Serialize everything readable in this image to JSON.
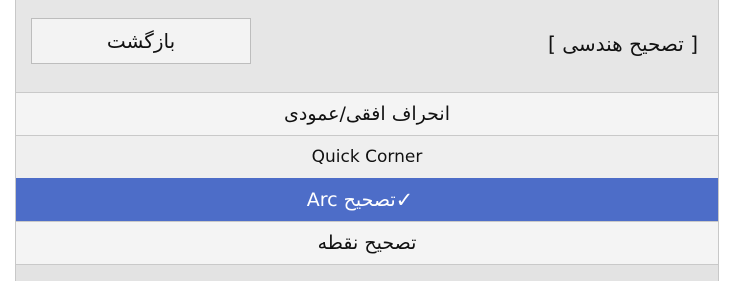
{
  "header": {
    "title": "[ تصحیح هندسی ]",
    "back_label": "بازگشت"
  },
  "menu": {
    "items": [
      {
        "label": "انحراف افقی/عمودی",
        "selected": false
      },
      {
        "label": "Quick Corner",
        "selected": false
      },
      {
        "label": "تصحیح Arc",
        "selected": true,
        "check": "✓"
      },
      {
        "label": "تصحیح نقطه",
        "selected": false
      }
    ]
  },
  "colors": {
    "selected_bg": "#4d6dc8",
    "panel_bg": "#e6e6e6"
  }
}
